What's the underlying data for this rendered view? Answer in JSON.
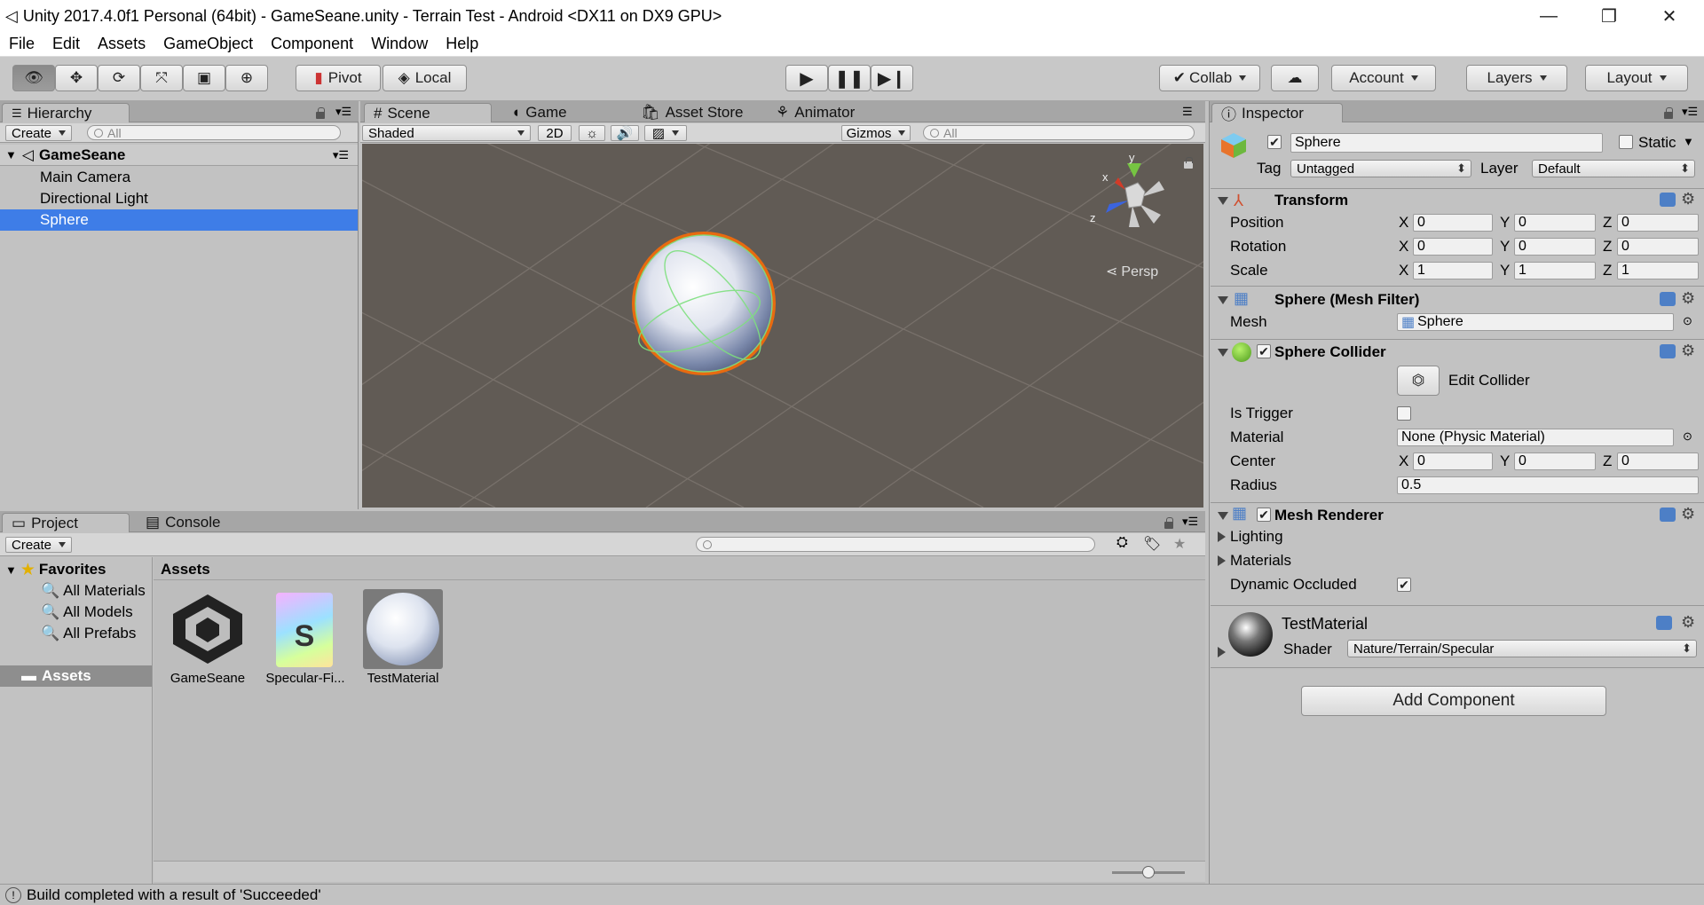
{
  "window": {
    "title": "Unity 2017.4.0f1 Personal (64bit) - GameSeane.unity - Terrain Test - Android <DX11 on DX9 GPU>"
  },
  "menu": [
    "File",
    "Edit",
    "Assets",
    "GameObject",
    "Component",
    "Window",
    "Help"
  ],
  "toolbar": {
    "pivot": "Pivot",
    "local": "Local",
    "collab": "Collab",
    "account": "Account",
    "layers": "Layers",
    "layout": "Layout"
  },
  "hierarchy": {
    "tab": "Hierarchy",
    "create": "Create",
    "search_placeholder": "All",
    "scene": "GameSeane",
    "items": [
      "Main Camera",
      "Directional Light",
      "Sphere"
    ]
  },
  "scene": {
    "tabs": [
      "Scene",
      "Game",
      "Asset Store",
      "Animator"
    ],
    "shading": "Shaded",
    "mode2d": "2D",
    "gizmos": "Gizmos",
    "search_placeholder": "All",
    "persp": "Persp",
    "axis_y": "y",
    "axis_x": "x",
    "axis_z": "z"
  },
  "project": {
    "tabs": [
      "Project",
      "Console"
    ],
    "create": "Create",
    "favorites": "Favorites",
    "fav_items": [
      "All Materials",
      "All Models",
      "All Prefabs"
    ],
    "assets_folder": "Assets",
    "assets_header": "Assets",
    "assets": [
      "GameSeane",
      "Specular-Fi...",
      "TestMaterial"
    ]
  },
  "inspector": {
    "tab": "Inspector",
    "name": "Sphere",
    "static": "Static",
    "tag_label": "Tag",
    "tag": "Untagged",
    "layer_label": "Layer",
    "layer": "Default",
    "transform": {
      "title": "Transform",
      "position": "Position",
      "rotation": "Rotation",
      "scale": "Scale",
      "x": "X",
      "y": "Y",
      "z": "Z",
      "pos": [
        "0",
        "0",
        "0"
      ],
      "rot": [
        "0",
        "0",
        "0"
      ],
      "scl": [
        "1",
        "1",
        "1"
      ]
    },
    "meshfilter": {
      "title": "Sphere (Mesh Filter)",
      "mesh_label": "Mesh",
      "mesh": "Sphere"
    },
    "collider": {
      "title": "Sphere Collider",
      "edit": "Edit Collider",
      "is_trigger": "Is Trigger",
      "material_label": "Material",
      "material": "None (Physic Material)",
      "center": "Center",
      "center_vals": [
        "0",
        "0",
        "0"
      ],
      "radius_label": "Radius",
      "radius": "0.5"
    },
    "renderer": {
      "title": "Mesh Renderer",
      "lighting": "Lighting",
      "materials": "Materials",
      "dynamic": "Dynamic Occluded"
    },
    "material": {
      "name": "TestMaterial",
      "shader_label": "Shader",
      "shader": "Nature/Terrain/Specular"
    },
    "add_component": "Add Component"
  },
  "status": "Build completed with a result of 'Succeeded'"
}
